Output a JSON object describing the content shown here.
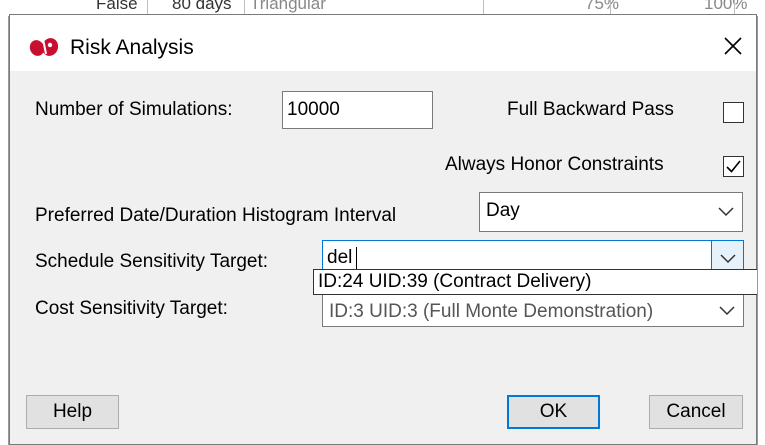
{
  "background_row": {
    "cell1": "False",
    "cell2": "80 days",
    "cell3": "Triangular",
    "cell4": "75%",
    "cell5": "100%"
  },
  "dialog": {
    "title": "Risk Analysis",
    "close_icon": "close-icon",
    "app_icon": "app-logo-icon"
  },
  "simulations": {
    "label": "Number of Simulations:",
    "value": "10000"
  },
  "full_backward_pass": {
    "label": "Full Backward Pass",
    "checked": false
  },
  "always_honor_constraints": {
    "label": "Always Honor Constraints",
    "checked": true
  },
  "histogram_interval": {
    "label": "Preferred Date/Duration Histogram Interval",
    "value": "Day"
  },
  "schedule_target": {
    "label": "Schedule Sensitivity Target:",
    "value": "del",
    "suggestions": [
      "ID:24  UID:39 (Contract Delivery)"
    ]
  },
  "cost_target": {
    "label": "Cost Sensitivity Target:",
    "value": "ID:3  UID:3 (Full Monte Demonstration)"
  },
  "buttons": {
    "help": "Help",
    "ok": "OK",
    "cancel": "Cancel"
  },
  "colors": {
    "accent": "#0078d7",
    "dialog_bg": "#f0f0f0",
    "logo_red": "#c8102e"
  }
}
